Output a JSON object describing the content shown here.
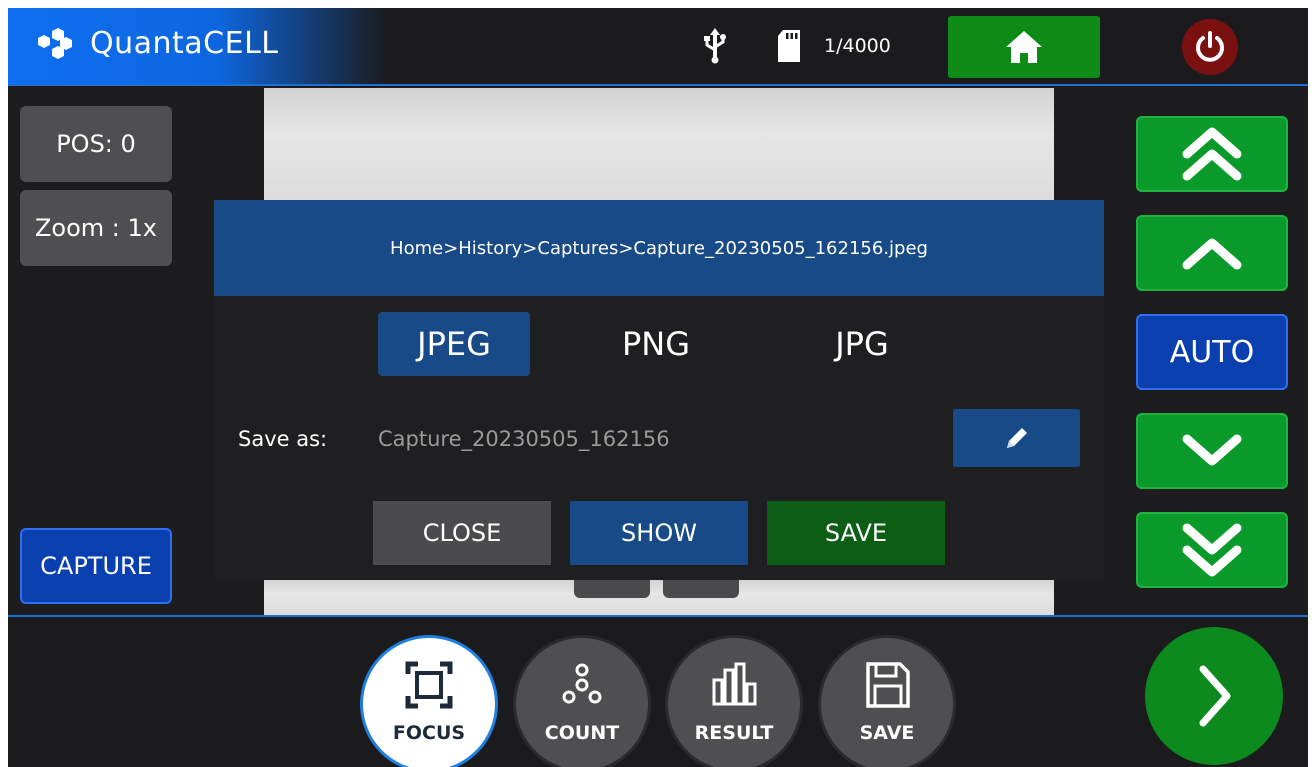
{
  "app": {
    "name": "QuantaCELL",
    "brand_color": "#0f6ff0",
    "logo_icon": "hexagon-cluster-logo"
  },
  "status": {
    "usb_icon": "usb-icon",
    "storage_icon": "sd-card-icon",
    "capture_count": "1/4000"
  },
  "header": {
    "home_icon": "home-icon",
    "power_icon": "power-icon"
  },
  "left_panel": {
    "pos_label": "POS: 0",
    "zoom_label": "Zoom : 1x",
    "capture_label": "CAPTURE"
  },
  "right_panel": {
    "fast_up_icon": "double-chevron-up-icon",
    "up_icon": "chevron-up-icon",
    "auto_label": "AUTO",
    "down_icon": "chevron-down-icon",
    "fast_down_icon": "double-chevron-down-icon"
  },
  "dialog": {
    "path": "Home>History>Captures>Capture_20230505_162156.jpeg",
    "formats": [
      "JPEG",
      "PNG",
      "JPG"
    ],
    "selected_format": "JPEG",
    "save_as_label": "Save as:",
    "filename": "Capture_20230505_162156",
    "edit_icon": "pencil-icon",
    "close_label": "CLOSE",
    "show_label": "SHOW",
    "save_label": "SAVE"
  },
  "bottom_nav": {
    "items": [
      {
        "label": "FOCUS",
        "icon": "focus-frame-icon",
        "active": true
      },
      {
        "label": "COUNT",
        "icon": "cells-icon",
        "active": false
      },
      {
        "label": "RESULT",
        "icon": "bar-chart-icon",
        "active": false
      },
      {
        "label": "SAVE",
        "icon": "floppy-disk-icon",
        "active": false
      }
    ],
    "next_icon": "chevron-right-icon"
  },
  "colors": {
    "accent_green": "#0a9a2a",
    "accent_blue": "#0a3fb0",
    "dialog_blue": "#174a86",
    "save_green": "#0b5e14",
    "power_red": "#7a1010"
  }
}
